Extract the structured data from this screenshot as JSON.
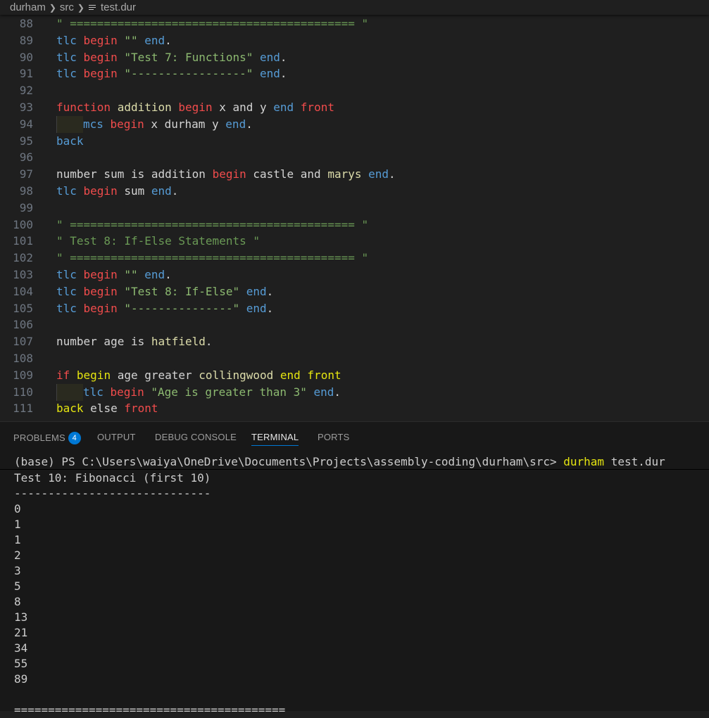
{
  "breadcrumb": {
    "items": [
      "durham",
      "src",
      "test.dur"
    ],
    "file_icon": "file-lines-icon"
  },
  "editor": {
    "lines": [
      {
        "n": "88",
        "indent": false,
        "tokens": [
          [
            "t-str",
            "\" ========================================== \""
          ]
        ]
      },
      {
        "n": "89",
        "indent": false,
        "tokens": [
          [
            "t-kw-blue",
            "tlc "
          ],
          [
            "t-kw-red",
            "begin "
          ],
          [
            "t-str2",
            "\"\" "
          ],
          [
            "t-kw-blue",
            "end"
          ],
          [
            "t-plain",
            "."
          ]
        ]
      },
      {
        "n": "90",
        "indent": false,
        "tokens": [
          [
            "t-kw-blue",
            "tlc "
          ],
          [
            "t-kw-red",
            "begin "
          ],
          [
            "t-str2",
            "\"Test 7: Functions\" "
          ],
          [
            "t-kw-blue",
            "end"
          ],
          [
            "t-plain",
            "."
          ]
        ]
      },
      {
        "n": "91",
        "indent": false,
        "tokens": [
          [
            "t-kw-blue",
            "tlc "
          ],
          [
            "t-kw-red",
            "begin "
          ],
          [
            "t-str2",
            "\"-----------------\" "
          ],
          [
            "t-kw-blue",
            "end"
          ],
          [
            "t-plain",
            "."
          ]
        ]
      },
      {
        "n": "92",
        "indent": false,
        "tokens": []
      },
      {
        "n": "93",
        "indent": false,
        "tokens": [
          [
            "t-kw-red",
            "function "
          ],
          [
            "t-fn",
            "addition "
          ],
          [
            "t-kw-red",
            "begin "
          ],
          [
            "t-plain",
            "x and y "
          ],
          [
            "t-kw-blue",
            "end "
          ],
          [
            "t-kw-red",
            "front"
          ]
        ]
      },
      {
        "n": "94",
        "indent": true,
        "tokens": [
          [
            "t-kw-blue",
            "mcs "
          ],
          [
            "t-kw-red",
            "begin "
          ],
          [
            "t-plain",
            "x durham y "
          ],
          [
            "t-kw-blue",
            "end"
          ],
          [
            "t-plain",
            "."
          ]
        ]
      },
      {
        "n": "95",
        "indent": false,
        "tokens": [
          [
            "t-kw-blue",
            "back"
          ]
        ]
      },
      {
        "n": "96",
        "indent": false,
        "tokens": []
      },
      {
        "n": "97",
        "indent": false,
        "tokens": [
          [
            "t-plain",
            "number sum is addition "
          ],
          [
            "t-kw-red",
            "begin "
          ],
          [
            "t-plain",
            "castle and "
          ],
          [
            "t-fn",
            "marys "
          ],
          [
            "t-kw-blue",
            "end"
          ],
          [
            "t-plain",
            "."
          ]
        ]
      },
      {
        "n": "98",
        "indent": false,
        "tokens": [
          [
            "t-kw-blue",
            "tlc "
          ],
          [
            "t-kw-red",
            "begin "
          ],
          [
            "t-plain",
            "sum "
          ],
          [
            "t-kw-blue",
            "end"
          ],
          [
            "t-plain",
            "."
          ]
        ]
      },
      {
        "n": "99",
        "indent": false,
        "tokens": []
      },
      {
        "n": "100",
        "indent": false,
        "tokens": [
          [
            "t-str",
            "\" ========================================== \""
          ]
        ]
      },
      {
        "n": "101",
        "indent": false,
        "tokens": [
          [
            "t-str",
            "\" Test 8: If-Else Statements \""
          ]
        ]
      },
      {
        "n": "102",
        "indent": false,
        "tokens": [
          [
            "t-str",
            "\" ========================================== \""
          ]
        ]
      },
      {
        "n": "103",
        "indent": false,
        "tokens": [
          [
            "t-kw-blue",
            "tlc "
          ],
          [
            "t-kw-red",
            "begin "
          ],
          [
            "t-str2",
            "\"\" "
          ],
          [
            "t-kw-blue",
            "end"
          ],
          [
            "t-plain",
            "."
          ]
        ]
      },
      {
        "n": "104",
        "indent": false,
        "tokens": [
          [
            "t-kw-blue",
            "tlc "
          ],
          [
            "t-kw-red",
            "begin "
          ],
          [
            "t-str2",
            "\"Test 8: If-Else\" "
          ],
          [
            "t-kw-blue",
            "end"
          ],
          [
            "t-plain",
            "."
          ]
        ]
      },
      {
        "n": "105",
        "indent": false,
        "tokens": [
          [
            "t-kw-blue",
            "tlc "
          ],
          [
            "t-kw-red",
            "begin "
          ],
          [
            "t-str2",
            "\"---------------\" "
          ],
          [
            "t-kw-blue",
            "end"
          ],
          [
            "t-plain",
            "."
          ]
        ]
      },
      {
        "n": "106",
        "indent": false,
        "tokens": []
      },
      {
        "n": "107",
        "indent": false,
        "tokens": [
          [
            "t-plain",
            "number age is "
          ],
          [
            "t-fn",
            "hatfield"
          ],
          [
            "t-plain",
            "."
          ]
        ]
      },
      {
        "n": "108",
        "indent": false,
        "tokens": []
      },
      {
        "n": "109",
        "indent": false,
        "tokens": [
          [
            "t-kw-red",
            "if "
          ],
          [
            "t-kw-yellow",
            "begin "
          ],
          [
            "t-plain",
            "age greater "
          ],
          [
            "t-fn",
            "collingwood "
          ],
          [
            "t-kw-yellow",
            "end front"
          ]
        ]
      },
      {
        "n": "110",
        "indent": true,
        "tokens": [
          [
            "t-kw-blue",
            "tlc "
          ],
          [
            "t-kw-red",
            "begin "
          ],
          [
            "t-str2",
            "\"Age is greater than 3\" "
          ],
          [
            "t-kw-blue",
            "end"
          ],
          [
            "t-plain",
            "."
          ]
        ]
      },
      {
        "n": "111",
        "indent": false,
        "tokens": [
          [
            "t-kw-yellow",
            "back "
          ],
          [
            "t-plain",
            "else "
          ],
          [
            "t-kw-red",
            "front"
          ]
        ]
      }
    ]
  },
  "panel": {
    "tabs": [
      {
        "label": "PROBLEMS",
        "badge": "4",
        "active": false
      },
      {
        "label": "OUTPUT",
        "active": false
      },
      {
        "label": "DEBUG CONSOLE",
        "active": false
      },
      {
        "label": "TERMINAL",
        "active": true
      },
      {
        "label": "PORTS",
        "active": false
      }
    ],
    "terminal": {
      "prompt": "(base) PS C:\\Users\\waiya\\OneDrive\\Documents\\Projects\\assembly-coding\\durham\\src> ",
      "command": "durham",
      "args": " test.dur",
      "output": [
        "Test 10: Fibonacci (first 10)",
        "-----------------------------",
        "0",
        "1",
        "1",
        "2",
        "3",
        "5",
        "8",
        "13",
        "21",
        "34",
        "55",
        "89",
        "",
        "========================================"
      ]
    }
  },
  "colors": {
    "background": "#1f1f1f",
    "panel_background": "#181818",
    "accent": "#0078d4",
    "keyword_blue": "#569cd6",
    "keyword_red": "#f14c4c",
    "keyword_yellow": "#e5e510",
    "string_green": "#6a9955"
  }
}
